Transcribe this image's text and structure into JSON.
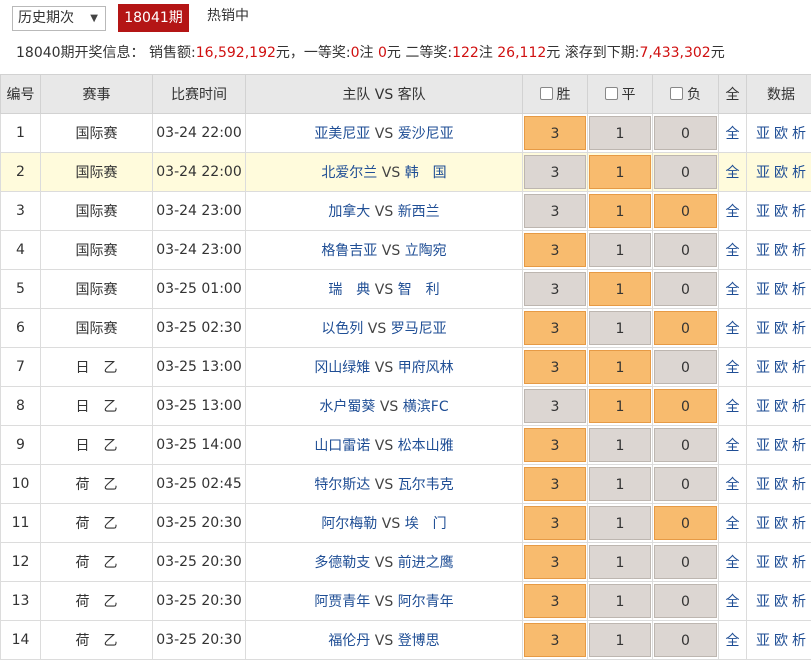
{
  "top": {
    "history_select": "历史期次",
    "issue_button": "18041期",
    "hot_label": "热销中"
  },
  "info": {
    "prefix": "18040期开奖信息：",
    "sales_label": "销售额:",
    "sales_value": "16,592,192",
    "first_prize_label": "元，一等奖:",
    "first_count": "0",
    "first_unit": "注",
    "first_amount": "0",
    "second_label": "元   二等奖:",
    "second_count": "122",
    "second_unit": "注",
    "second_amount": "26,112",
    "rollover_label": "元  滚存到下期:",
    "rollover_value": "7,433,302",
    "end": "元"
  },
  "headers": {
    "num": "编号",
    "league": "赛事",
    "time": "比赛时间",
    "teams": "主队 VS 客队",
    "win": "胜",
    "draw": "平",
    "lose": "负",
    "all": "全",
    "data": "数据"
  },
  "vs_text": "VS",
  "odds_values": [
    "3",
    "1",
    "0"
  ],
  "row_all_label": "全",
  "row_links": [
    "亚",
    "欧",
    "析"
  ],
  "colors": {
    "selected": "#f8bb6e",
    "unselected": "#dcd6d2",
    "issue": "#b41515",
    "team": "#1f4e95",
    "red": "#d01010"
  },
  "matches": [
    {
      "num": "1",
      "league": "国际赛",
      "time": "03-24 22:00",
      "home": "亚美尼亚",
      "away": "爱沙尼亚",
      "sel": [
        true,
        false,
        false
      ],
      "hl": false
    },
    {
      "num": "2",
      "league": "国际赛",
      "time": "03-24 22:00",
      "home": "北爱尔兰",
      "away": "韩　国",
      "sel": [
        false,
        true,
        false
      ],
      "hl": true
    },
    {
      "num": "3",
      "league": "国际赛",
      "time": "03-24 23:00",
      "home": "加拿大",
      "away": "新西兰",
      "sel": [
        false,
        true,
        true
      ],
      "hl": false
    },
    {
      "num": "4",
      "league": "国际赛",
      "time": "03-24 23:00",
      "home": "格鲁吉亚",
      "away": "立陶宛",
      "sel": [
        true,
        false,
        false
      ],
      "hl": false
    },
    {
      "num": "5",
      "league": "国际赛",
      "time": "03-25 01:00",
      "home": "瑞　典",
      "away": "智　利",
      "sel": [
        false,
        true,
        false
      ],
      "hl": false
    },
    {
      "num": "6",
      "league": "国际赛",
      "time": "03-25 02:30",
      "home": "以色列",
      "away": "罗马尼亚",
      "sel": [
        true,
        false,
        true
      ],
      "hl": false
    },
    {
      "num": "7",
      "league": "日　乙",
      "time": "03-25 13:00",
      "home": "冈山绿雉",
      "away": "甲府风林",
      "sel": [
        true,
        true,
        false
      ],
      "hl": false
    },
    {
      "num": "8",
      "league": "日　乙",
      "time": "03-25 13:00",
      "home": "水户蜀葵",
      "away": "横滨FC",
      "sel": [
        false,
        true,
        true
      ],
      "hl": false
    },
    {
      "num": "9",
      "league": "日　乙",
      "time": "03-25 14:00",
      "home": "山口雷诺",
      "away": "松本山雅",
      "sel": [
        true,
        false,
        false
      ],
      "hl": false
    },
    {
      "num": "10",
      "league": "荷　乙",
      "time": "03-25 02:45",
      "home": "特尔斯达",
      "away": "瓦尔韦克",
      "sel": [
        true,
        false,
        false
      ],
      "hl": false
    },
    {
      "num": "11",
      "league": "荷　乙",
      "time": "03-25 20:30",
      "home": "阿尔梅勒",
      "away": "埃　门",
      "sel": [
        true,
        false,
        true
      ],
      "hl": false
    },
    {
      "num": "12",
      "league": "荷　乙",
      "time": "03-25 20:30",
      "home": "多德勒支",
      "away": "前进之鹰",
      "sel": [
        true,
        false,
        false
      ],
      "hl": false
    },
    {
      "num": "13",
      "league": "荷　乙",
      "time": "03-25 20:30",
      "home": "阿贾青年",
      "away": "阿尔青年",
      "sel": [
        true,
        false,
        false
      ],
      "hl": false
    },
    {
      "num": "14",
      "league": "荷　乙",
      "time": "03-25 20:30",
      "home": "福伦丹",
      "away": "登博思",
      "sel": [
        true,
        false,
        false
      ],
      "hl": false
    }
  ]
}
